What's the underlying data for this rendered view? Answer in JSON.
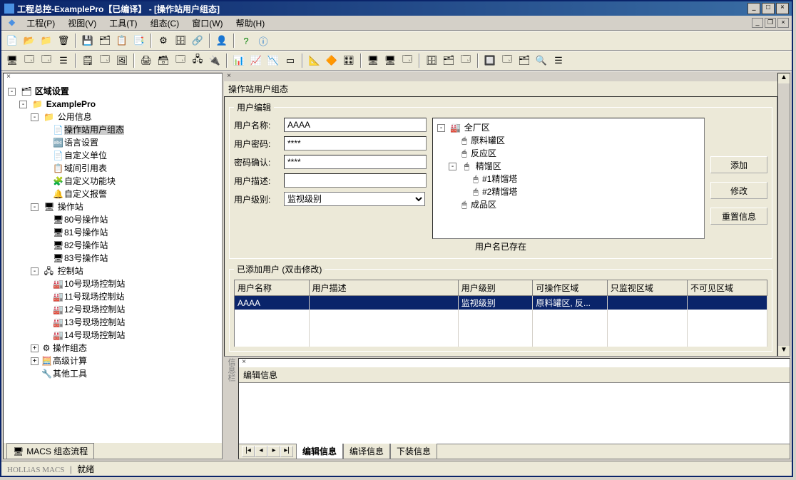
{
  "window": {
    "title": "工程总控-ExamplePro【已编译】 - [操作站用户组态]"
  },
  "menu": {
    "items": [
      {
        "label": "工程(P)"
      },
      {
        "label": "视图(V)"
      },
      {
        "label": "工具(T)"
      },
      {
        "label": "组态(C)"
      },
      {
        "label": "窗口(W)"
      },
      {
        "label": "帮助(H)"
      }
    ]
  },
  "left_panel": {
    "root": "区域设置",
    "project": "ExamplePro",
    "groups": [
      {
        "label": "公用信息",
        "children": [
          {
            "label": "操作站用户组态",
            "selected": true
          },
          {
            "label": "语言设置"
          },
          {
            "label": "自定义单位"
          },
          {
            "label": "域间引用表"
          },
          {
            "label": "自定义功能块"
          },
          {
            "label": "自定义报警"
          }
        ]
      },
      {
        "label": "操作站",
        "children": [
          {
            "label": "80号操作站"
          },
          {
            "label": "81号操作站"
          },
          {
            "label": "82号操作站"
          },
          {
            "label": "83号操作站"
          }
        ]
      },
      {
        "label": "控制站",
        "children": [
          {
            "label": "10号现场控制站"
          },
          {
            "label": "11号现场控制站"
          },
          {
            "label": "12号现场控制站"
          },
          {
            "label": "13号现场控制站"
          },
          {
            "label": "14号现场控制站"
          }
        ]
      },
      {
        "label": "操作组态",
        "children": []
      },
      {
        "label": "高级计算",
        "children": []
      },
      {
        "label": "其他工具",
        "children": []
      }
    ],
    "tab_label": "MACS 组态流程"
  },
  "main_panel": {
    "title": "操作站用户组态",
    "user_edit": {
      "legend": "用户编辑",
      "labels": {
        "username": "用户名称:",
        "password": "用户密码:",
        "confirm": "密码确认:",
        "description": "用户描述:",
        "level": "用户级别:"
      },
      "values": {
        "username": "AAAA",
        "password": "****",
        "confirm": "****",
        "description": "",
        "level": "监视级别"
      },
      "buttons": {
        "add": "添加",
        "modify": "修改",
        "reset": "重置信息"
      },
      "status_msg": "用户名已存在"
    },
    "region_tree": {
      "root": "全厂区",
      "items": [
        {
          "label": "原料罐区"
        },
        {
          "label": "反应区"
        },
        {
          "label": "精馏区",
          "children": [
            {
              "label": "#1精馏塔"
            },
            {
              "label": "#2精馏塔"
            }
          ]
        },
        {
          "label": "成品区"
        }
      ]
    },
    "added_users": {
      "legend": "已添加用户 (双击修改)",
      "columns": [
        "用户名称",
        "用户描述",
        "用户级别",
        "可操作区域",
        "只监视区域",
        "不可见区域"
      ],
      "rows": [
        {
          "name": "AAAA",
          "desc": "",
          "level": "监视级别",
          "op": "原料罐区, 反...",
          "mon": "",
          "hid": "",
          "selected": true
        }
      ]
    }
  },
  "info_panel": {
    "title": "编辑信息",
    "side_label": "信息栏",
    "tabs": [
      "编辑信息",
      "编译信息",
      "下装信息"
    ],
    "active_tab": 0
  },
  "statusbar": {
    "brand": "HOLLiAS MACS",
    "text": "就绪"
  }
}
